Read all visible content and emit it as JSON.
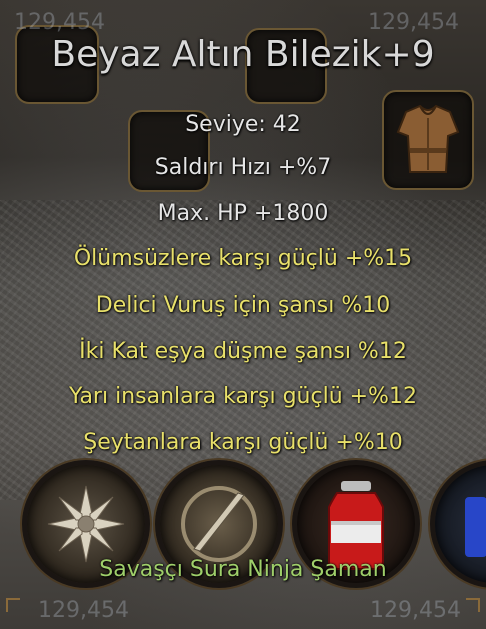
{
  "tooltip": {
    "title": "Beyaz Altın Bilezik+9",
    "level": "Seviye: 42",
    "stats": [
      "Saldırı Hızı +%7",
      "Max. HP +1800"
    ],
    "bonuses": [
      "Ölümsüzlere karşı güçlü +%15",
      "Delici Vuruş için şansı %10",
      "İki Kat eşya düşme şansı %12",
      "Yarı insanlara karşı güçlü +%12",
      "Şeytanlara karşı güçlü +%10"
    ],
    "classes": "Savaşçı Sura Ninja Şaman"
  },
  "background": {
    "stat_value": "129,454"
  },
  "colors": {
    "title": "#d8d8d8",
    "base_stats": "#e6e6e6",
    "bonus": "#e8e06a",
    "classes": "#9fcf6a"
  },
  "icons": {
    "armor_slot": "tunic-icon",
    "skill_1": "star-sun-icon",
    "skill_2": "blade-circle-icon",
    "potion": "red-potion-icon"
  }
}
